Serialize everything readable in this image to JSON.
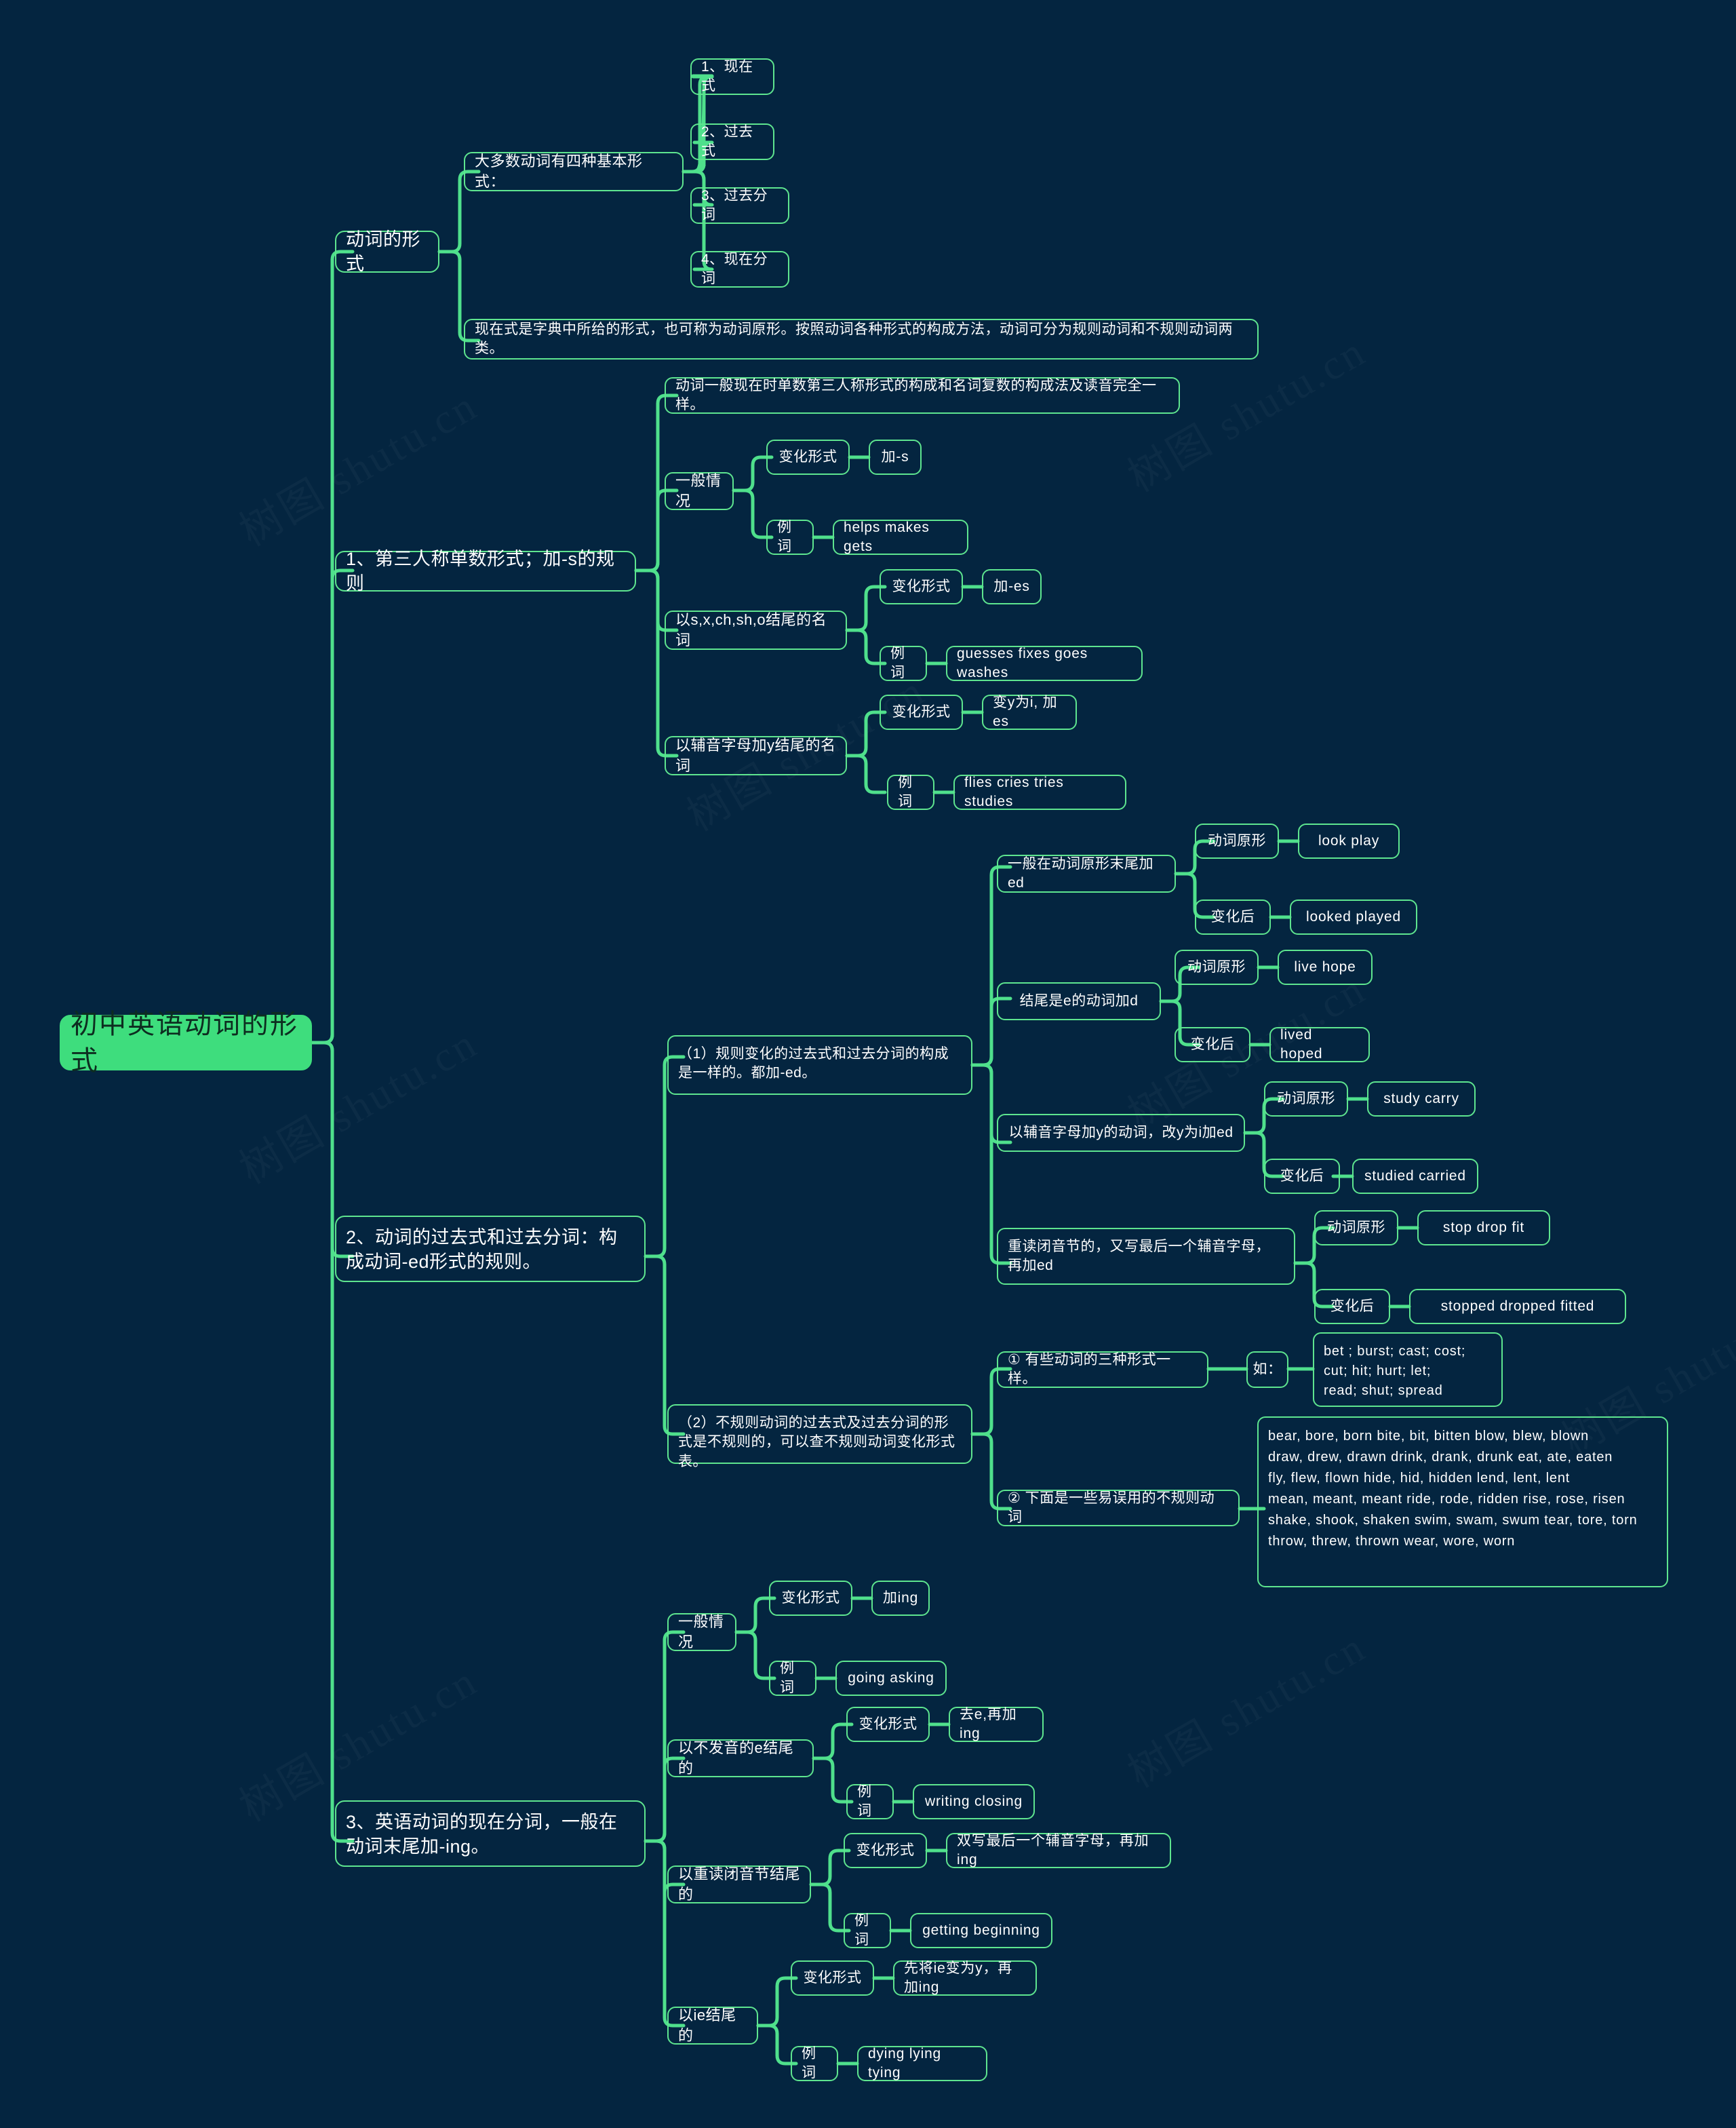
{
  "meta": {
    "background_color": "#042540",
    "accent_color": "#5ee58f",
    "root_fill": "#3edd7d",
    "watermark_text": "树图 shutu.cn"
  },
  "root": {
    "label": "初中英语动词的形式"
  },
  "branches": [
    {
      "id": "verb-forms",
      "label": "动词的形式",
      "children": [
        {
          "id": "four-basic-forms",
          "label": "大多数动词有四种基本形式：",
          "children": [
            {
              "id": "present",
              "label": "1、现在式"
            },
            {
              "id": "past",
              "label": "2、过去式"
            },
            {
              "id": "past-participle",
              "label": "3、过去分词"
            },
            {
              "id": "present-participle",
              "label": "4、现在分词"
            }
          ]
        },
        {
          "id": "dictionary-note",
          "label": "现在式是字典中所给的形式，也可称为动词原形。按照动词各种形式的构成方法，动词可分为规则动词和不规则动词两类。"
        }
      ]
    },
    {
      "id": "third-person-singular",
      "label": "1、第三人称单数形式；加-s的规则",
      "children": [
        {
          "id": "tps-note",
          "label": "动词一般现在时单数第三人称形式的构成和名词复数的构成法及读音完全一样。"
        },
        {
          "id": "tps-general",
          "label": "一般情况",
          "children": [
            {
              "id": "tps-general-rule",
              "label": "变化形式",
              "value": "加-s"
            },
            {
              "id": "tps-general-examples",
              "label": "例词",
              "value": "helps  makes  gets"
            }
          ]
        },
        {
          "id": "tps-sxchsho",
          "label": "以s,x,ch,sh,o结尾的名词",
          "children": [
            {
              "id": "tps-sxchsho-rule",
              "label": "变化形式",
              "value": "加-es"
            },
            {
              "id": "tps-sxchsho-examples",
              "label": "例词",
              "value": "guesses  fixes  goes  washes"
            }
          ]
        },
        {
          "id": "tps-consonant-y",
          "label": "以辅音字母加y结尾的名词",
          "children": [
            {
              "id": "tps-consonant-y-rule",
              "label": "变化形式",
              "value": "变y为i, 加es"
            },
            {
              "id": "tps-consonant-y-examples",
              "label": "例词",
              "value": "flies  cries  tries  studies"
            }
          ]
        }
      ]
    },
    {
      "id": "past-and-participle",
      "label": "2、动词的过去式和过去分词：构成动词-ed形式的规则。",
      "children": [
        {
          "id": "regular",
          "label": "（1）规则变化的过去式和过去分词的构成是一样的。都加-ed。",
          "children": [
            {
              "id": "reg-add-ed",
              "label": "一般在动词原形末尾加ed",
              "base_label": "动词原形",
              "base_value": "look  play",
              "changed_label": "变化后",
              "changed_value": "looked  played"
            },
            {
              "id": "reg-end-e",
              "label": "结尾是e的动词加d",
              "base_label": "动词原形",
              "base_value": "live  hope",
              "changed_label": "变化后",
              "changed_value": "lived   hoped"
            },
            {
              "id": "reg-consonant-y",
              "label": "以辅音字母加y的动词，改y为i加ed",
              "base_label": "动词原形",
              "base_value": "study  carry",
              "changed_label": "变化后",
              "changed_value": "studied  carried"
            },
            {
              "id": "reg-double-consonant",
              "label": "重读闭音节的，又写最后一个辅音字母，再加ed",
              "base_label": "动词原形",
              "base_value": "stop  drop  fit",
              "changed_label": "变化后",
              "changed_value": "stopped  dropped  fitted"
            }
          ]
        },
        {
          "id": "irregular",
          "label": "（2）不规则动词的过去式及过去分词的形式是不规则的，可以查不规则动词变化形式表。",
          "children": [
            {
              "id": "irr-same-three",
              "label": "① 有些动词的三种形式一样。",
              "example_label": "如：",
              "example_value": "bet ;    burst;   cast;   cost;\ncut;    hit;    hurt;   let;\nread;   shut;   spread"
            },
            {
              "id": "irr-confusing",
              "label": "② 下面是一些易误用的不规则动词",
              "list": "bear, bore, born   bite, bit, bitten   blow, blew, blown\ndraw, drew, drawn  drink, drank, drunk eat, ate, eaten\nfly, flew, flown   hide, hid, hidden  lend, lent, lent\nmean, meant, meant  ride, rode, ridden  rise, rose, risen\nshake, shook, shaken  swim, swam, swum tear, tore, torn\nthrow, threw, thrown  wear, wore, worn"
            }
          ]
        }
      ]
    },
    {
      "id": "present-participle-rules",
      "label": "3、英语动词的现在分词，一般在动词末尾加-ing。",
      "children": [
        {
          "id": "pp-general",
          "label": "一般情况",
          "children": [
            {
              "id": "pp-general-rule",
              "label": "变化形式",
              "value": "加ing"
            },
            {
              "id": "pp-general-examples",
              "label": "例词",
              "value": "going  asking"
            }
          ]
        },
        {
          "id": "pp-silent-e",
          "label": "以不发音的e结尾的",
          "children": [
            {
              "id": "pp-silent-e-rule",
              "label": "变化形式",
              "value": "去e,再加ing"
            },
            {
              "id": "pp-silent-e-examples",
              "label": "例词",
              "value": "writing  closing"
            }
          ]
        },
        {
          "id": "pp-stressed-closed",
          "label": "以重读闭音节结尾的",
          "children": [
            {
              "id": "pp-stressed-rule",
              "label": "变化形式",
              "value": "双写最后一个辅音字母，再加ing"
            },
            {
              "id": "pp-stressed-examples",
              "label": "例词",
              "value": "getting  beginning"
            }
          ]
        },
        {
          "id": "pp-ie",
          "label": "以ie结尾的",
          "children": [
            {
              "id": "pp-ie-rule",
              "label": "变化形式",
              "value": "先将ie变为y，再加ing"
            },
            {
              "id": "pp-ie-examples",
              "label": "例词",
              "value": "dying  lying tying"
            }
          ]
        }
      ]
    }
  ]
}
